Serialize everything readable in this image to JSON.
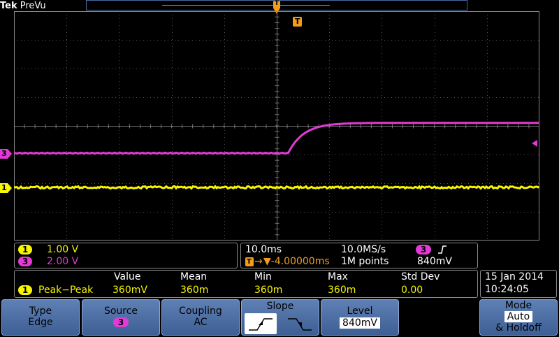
{
  "header": {
    "brand": "Tek",
    "mode": "PreVu",
    "trigger_marker": "T"
  },
  "markers": {
    "ch3": "3",
    "ch1": "1",
    "trigger": "T"
  },
  "colors": {
    "ch1": "#f7f500",
    "ch3": "#e23ad6",
    "trigger": "#f39c1c",
    "softkey": "#4a6ea6"
  },
  "channels": [
    {
      "num": "1",
      "scale": "1.00 V"
    },
    {
      "num": "3",
      "scale": "2.00 V"
    }
  ],
  "horizontal": {
    "timebase": "10.0ms",
    "sample_rate": "10.0MS/s",
    "trigger_source": "3",
    "trigger_slope_icon": "rising-edge-icon",
    "delay": "▼-4.00000ms",
    "record_length": "1M points",
    "trigger_level": "840mV"
  },
  "measurement": {
    "headers": [
      "Value",
      "Mean",
      "Min",
      "Max",
      "Std Dev"
    ],
    "channel": "1",
    "name": "Peak−Peak",
    "values": [
      "360mV",
      "360m",
      "360m",
      "360m",
      "0.00"
    ]
  },
  "datetime": {
    "date": "15 Jan 2014",
    "time": "10:24:05"
  },
  "softkeys": {
    "type": {
      "label": "Type",
      "value": "Edge"
    },
    "source": {
      "label": "Source",
      "value": "3"
    },
    "coupling": {
      "label": "Coupling",
      "value": "AC"
    },
    "slope": {
      "label": "Slope"
    },
    "level": {
      "label": "Level",
      "value": "840mV"
    },
    "mode": {
      "label": "Mode",
      "value": "Auto",
      "value2": "& Holdoff"
    }
  }
}
